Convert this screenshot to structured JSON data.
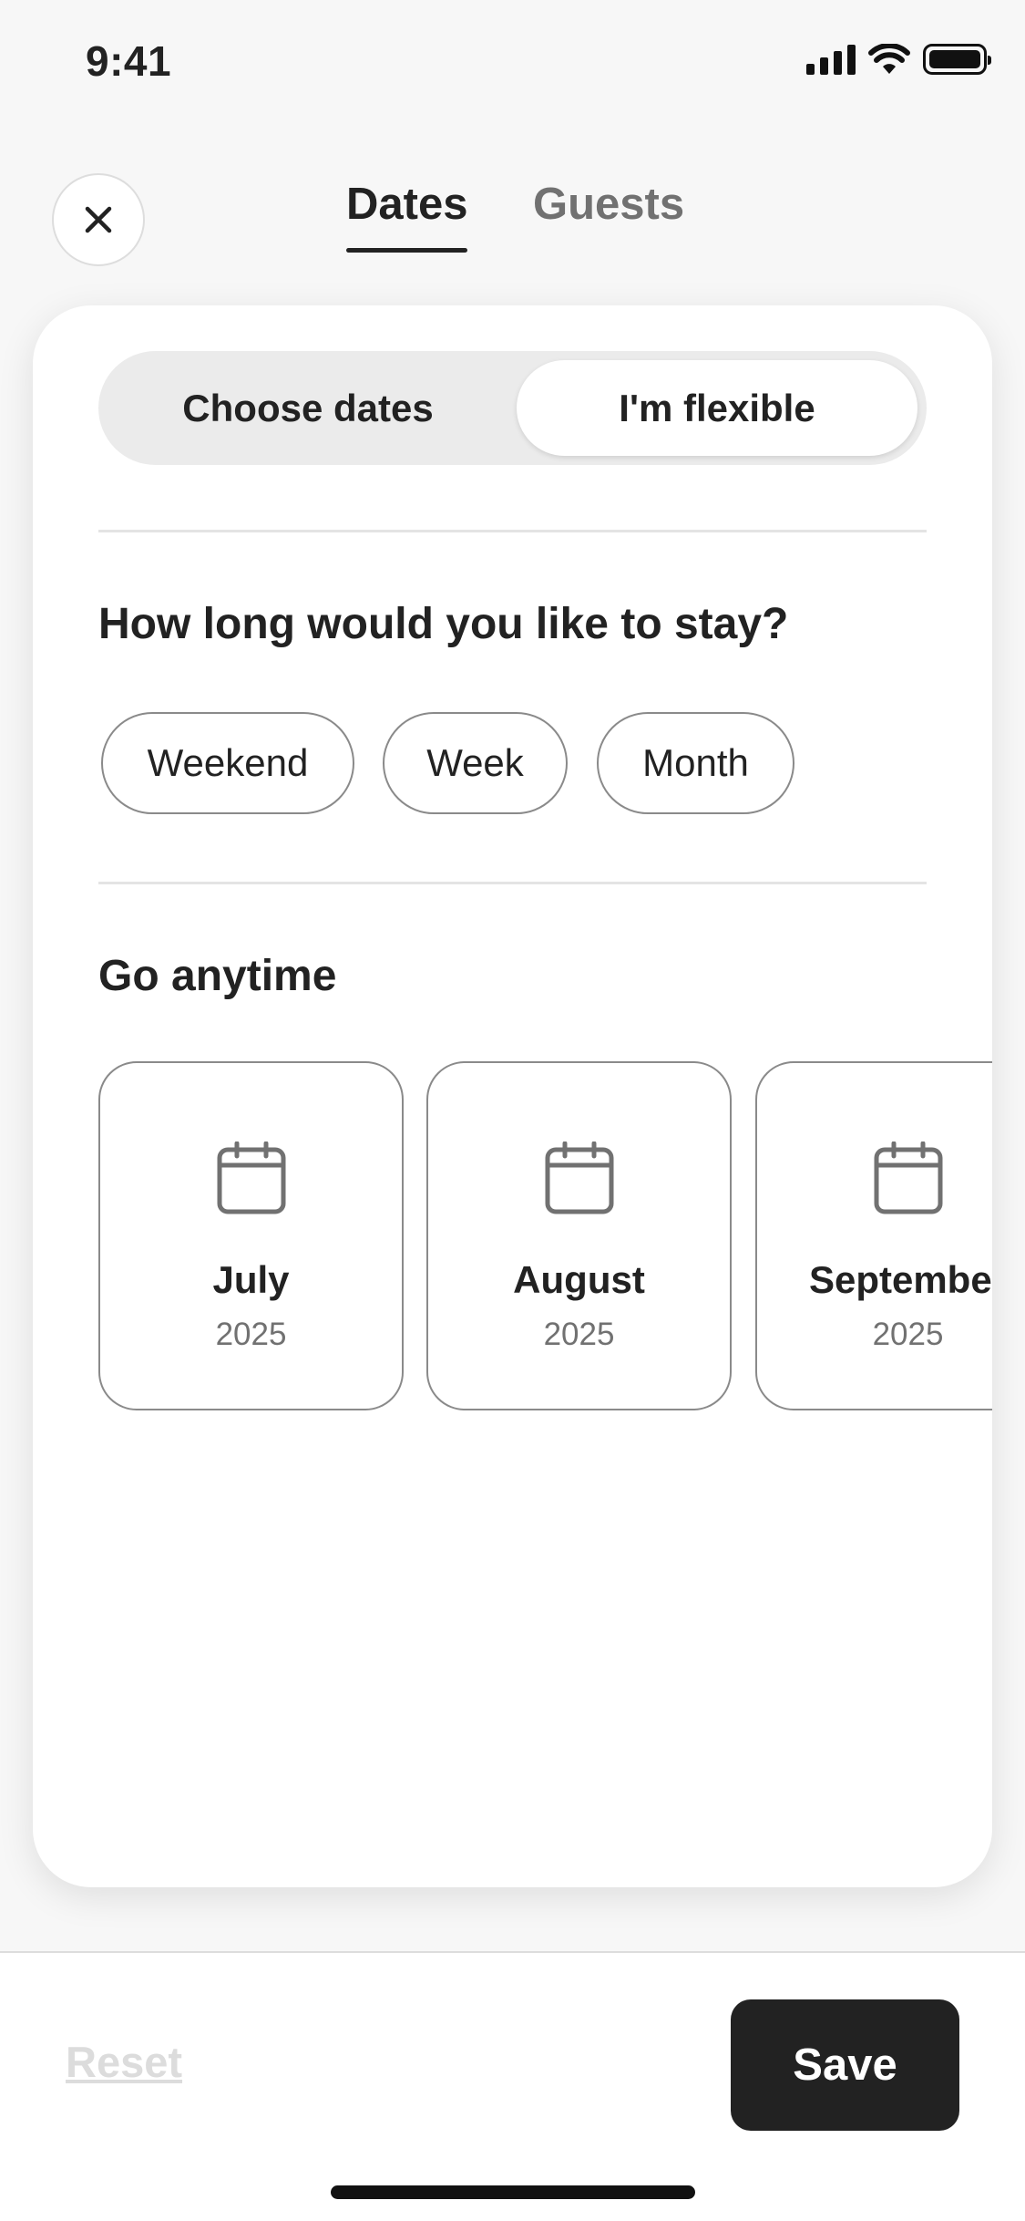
{
  "status_bar": {
    "time": "9:41",
    "icons": [
      "cellular-signal-icon",
      "wifi-icon",
      "battery-icon"
    ]
  },
  "header": {
    "close_icon": "close-icon",
    "tabs": [
      {
        "label": "Dates",
        "active": true
      },
      {
        "label": "Guests",
        "active": false
      }
    ]
  },
  "mode_toggle": {
    "options": [
      {
        "label": "Choose dates",
        "selected": false
      },
      {
        "label": "I'm flexible",
        "selected": true
      }
    ]
  },
  "stay_length": {
    "title": "How long would you like to stay?",
    "options": [
      {
        "label": "Weekend"
      },
      {
        "label": "Week"
      },
      {
        "label": "Month"
      }
    ]
  },
  "go_anytime": {
    "title": "Go anytime",
    "months": [
      {
        "month": "July",
        "year": "2025",
        "icon": "calendar-icon"
      },
      {
        "month": "August",
        "year": "2025",
        "icon": "calendar-icon"
      },
      {
        "month": "September",
        "year": "2025",
        "icon": "calendar-icon"
      }
    ]
  },
  "footer": {
    "reset_label": "Reset",
    "save_label": "Save"
  },
  "colors": {
    "text": "#222222",
    "muted": "#717171",
    "save_background": "#222222",
    "reset_disabled": "#dcdcdc",
    "toggle_track": "#ebebeb"
  }
}
